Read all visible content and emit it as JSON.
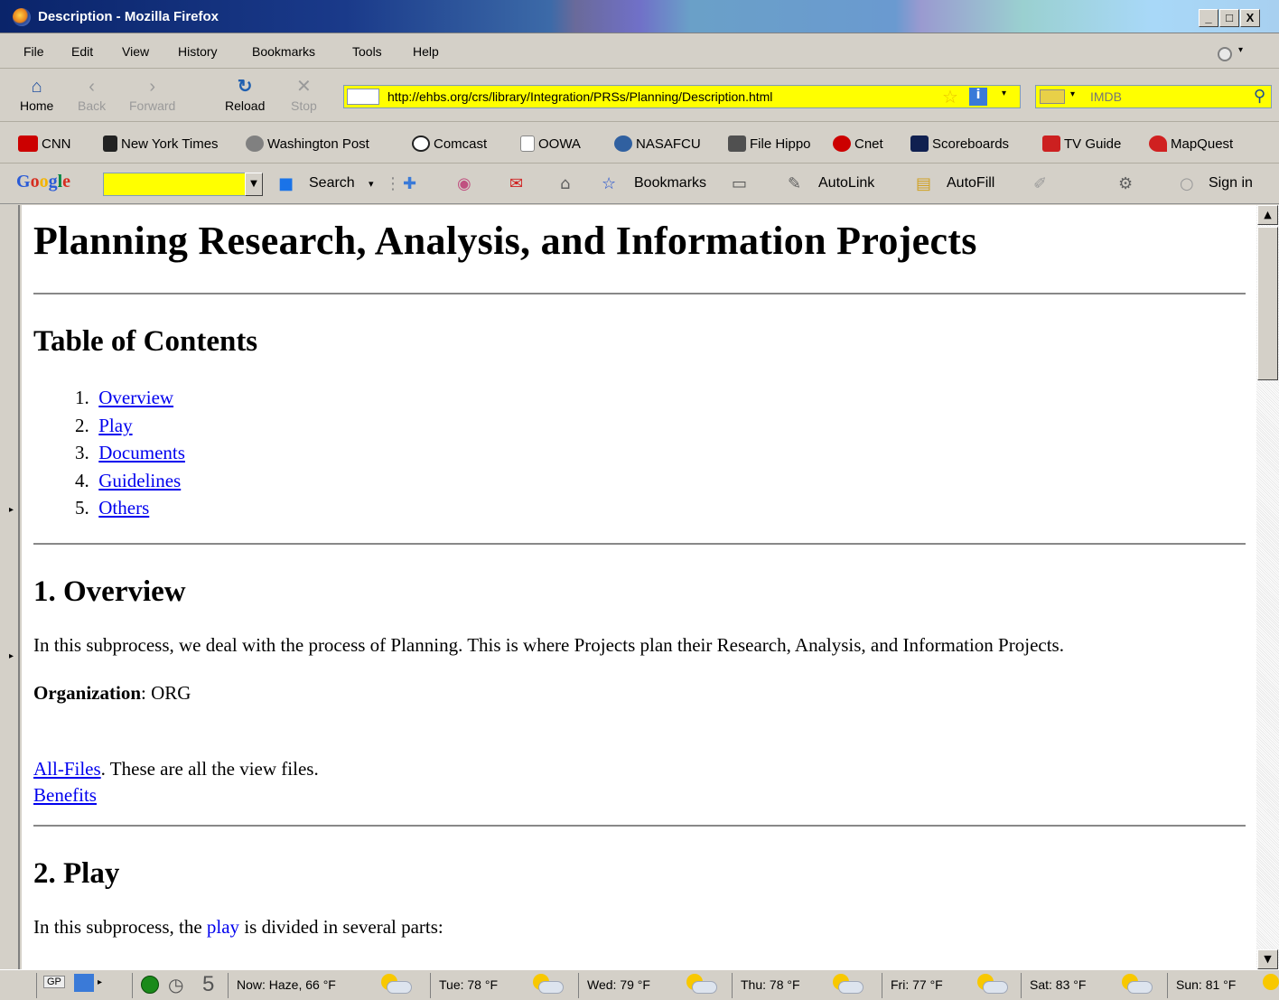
{
  "window": {
    "title": "Description - Mozilla Firefox",
    "controls": [
      "_",
      "□",
      "X"
    ]
  },
  "menubar": {
    "items": [
      "File",
      "Edit",
      "View",
      "History",
      "Bookmarks",
      "Tools",
      "Help"
    ]
  },
  "navbar": {
    "home": "Home",
    "back": "Back",
    "forward": "Forward",
    "reload": "Reload",
    "stop": "Stop",
    "url": "http://ehbs.org/crs/library/Integration/PRSs/Planning/Description.html",
    "search_placeholder": "IMDB"
  },
  "bookmarks": {
    "items": [
      {
        "label": "CNN",
        "icon": "cnn-icon",
        "color": "#cc0000"
      },
      {
        "label": "New York Times",
        "icon": "nyt-icon",
        "color": "#000000"
      },
      {
        "label": "Washington Post",
        "icon": "wapo-icon",
        "color": "#606060"
      },
      {
        "label": "Comcast",
        "icon": "comcast-icon",
        "color": "#202020"
      },
      {
        "label": "OOWA",
        "icon": "page-icon",
        "color": "#ffffff"
      },
      {
        "label": "NASAFCU",
        "icon": "nasafcu-icon",
        "color": "#3060a0"
      },
      {
        "label": "File Hippo",
        "icon": "filehippo-icon",
        "color": "#404040"
      },
      {
        "label": "Cnet",
        "icon": "cnet-icon",
        "color": "#cc0000"
      },
      {
        "label": "Scoreboards",
        "icon": "si-icon",
        "color": "#102050"
      },
      {
        "label": "TV Guide",
        "icon": "tvguide-icon",
        "color": "#cc2020"
      },
      {
        "label": "MapQuest",
        "icon": "mapquest-icon",
        "color": "#d02020"
      }
    ]
  },
  "google_toolbar": {
    "logo": "Google",
    "search": "Search",
    "bookmarks": "Bookmarks",
    "autolink": "AutoLink",
    "autofill": "AutoFill",
    "signin": "Sign in"
  },
  "page": {
    "title": "Planning Research, Analysis, and Information Projects",
    "toc_heading": "Table of Contents",
    "toc": [
      {
        "num": "1.",
        "label": "Overview"
      },
      {
        "num": "2.",
        "label": "Play"
      },
      {
        "num": "3.",
        "label": "Documents"
      },
      {
        "num": "4.",
        "label": "Guidelines"
      },
      {
        "num": "5.",
        "label": "Others"
      }
    ],
    "overview_heading": "1. Overview",
    "overview_text": "In this subprocess, we deal with the process of Planning. This is where Projects plan their Research, Analysis, and Information Projects.",
    "org_label": "Organization",
    "org_value": ": ORG",
    "allfiles_link": "All-Files",
    "allfiles_text": ". These are all the view files.",
    "benefits_link": "Benefits",
    "play_heading": "2. Play",
    "play_text_before": "In this subprocess, the ",
    "play_link": "play",
    "play_text_after": " is divided in several parts:"
  },
  "statusbar": {
    "gp": "GP",
    "counter": "5",
    "weather": [
      "Now: Haze, 66 °F",
      "Tue: 78 °F",
      "Wed: 79 °F",
      "Thu: 78 °F",
      "Fri: 77 °F",
      "Sat: 83 °F",
      "Sun: 81 °F"
    ]
  }
}
